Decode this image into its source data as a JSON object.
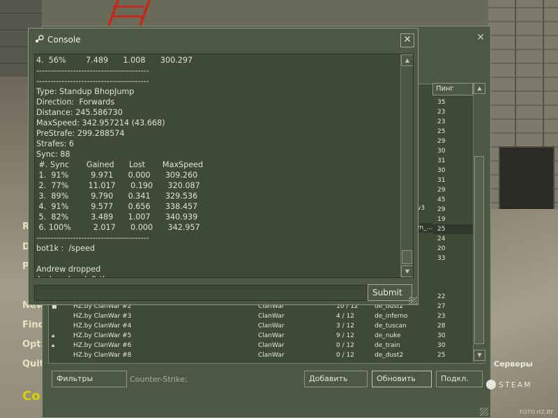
{
  "menu": {
    "items": [
      "R",
      "D",
      "P",
      "New",
      "Find",
      "Opt",
      "Quit"
    ],
    "logo_fragment": "Co"
  },
  "watermark": "FOTO.HZ.BY",
  "server_browser": {
    "close_glyph": "✕",
    "column_ping": "Пинг",
    "pings_upper": [
      "35",
      "23",
      "23",
      "25",
      "29",
      "30",
      "31",
      "30",
      "31",
      "29",
      "45",
      "29",
      "19",
      "25",
      "24",
      "20",
      "33"
    ],
    "fragments": {
      "v3": "v3",
      "vn": "vn_..."
    },
    "servers": [
      {
        "locked": true,
        "name": "HZ.by ClanWar #2",
        "type": "ClanWar",
        "players": "10 / 12",
        "map": "de_dust2",
        "ping": "27"
      },
      {
        "locked": false,
        "name": "HZ.by ClanWar #3",
        "type": "ClanWar",
        "players": "4 / 12",
        "map": "de_inferno",
        "ping": "23"
      },
      {
        "locked": false,
        "name": "HZ.by ClanWar #4",
        "type": "ClanWar",
        "players": "3 / 12",
        "map": "de_tuscan",
        "ping": "28"
      },
      {
        "locked": true,
        "name": "HZ.by ClanWar #5",
        "type": "ClanWar",
        "players": "9 / 12",
        "map": "de_nuke",
        "ping": "30"
      },
      {
        "locked": true,
        "name": "HZ.by ClanWar #6",
        "type": "ClanWar",
        "players": "0 / 12",
        "map": "de_train",
        "ping": "30"
      },
      {
        "locked": false,
        "name": "HZ.by ClanWar #8",
        "type": "ClanWar",
        "players": "0 / 12",
        "map": "de_dust2",
        "ping": "25"
      }
    ],
    "ping_22": "22",
    "buttons": {
      "filters": "Фильтры",
      "add": "Добавить",
      "refresh": "Обновить",
      "connect": "Подкл."
    },
    "filter_status": "Counter-Strike;",
    "servers_label": "Серверы",
    "steam_label": "STEAM"
  },
  "console": {
    "title": "Console",
    "close_glyph": "✕",
    "lines": [
      "4.  56%        7.489      1.008      300.297",
      "----------------------------------------",
      "----------------------------------------",
      "Type: Standup BhopJump",
      "Direction:  Forwards",
      "Distance: 245.586730",
      "MaxSpeed: 342.957214 (43.668)",
      "PreStrafe: 299.288574",
      "Strafes: 6",
      "Sync: 88",
      " #. Sync       Gained      Lost       MaxSpeed",
      " 1.  91%         9.971      0.000      309.260",
      " 2.  77%        11.017      0.190      320.087",
      " 3.  89%         9.790      0.341      329.536",
      " 4.  91%         9.577      0.656      338.457",
      " 5.  82%         3.489      1.007      340.939",
      " 6. 100%         2.017      0.000      342.957",
      "----------------------------------------",
      "bot1k :  /speed",
      "",
      "Andrew dropped",
      "Andrew has left the game"
    ],
    "input_value": "",
    "submit_label": "Submit"
  }
}
